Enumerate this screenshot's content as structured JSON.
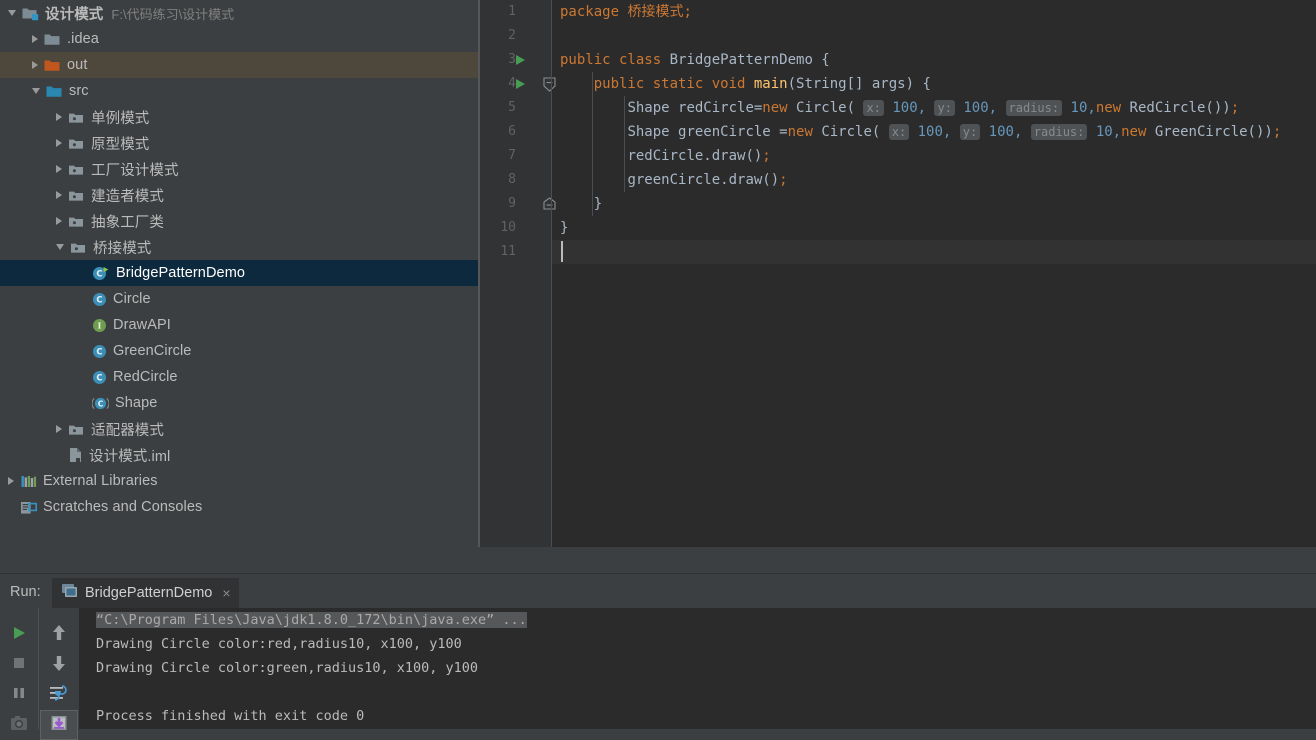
{
  "project_tree": {
    "items": [
      {
        "indent": 0,
        "arrow": "down",
        "icon": "module-folder-icon",
        "label": "设计模式",
        "path": "F:\\代码练习\\设计模式",
        "state": "normal",
        "bold": true
      },
      {
        "indent": 1,
        "arrow": "right",
        "icon": "folder-gray-icon",
        "label": ".idea",
        "path": "",
        "state": "normal",
        "bold": false
      },
      {
        "indent": 1,
        "arrow": "right",
        "icon": "folder-orange-icon",
        "label": "out",
        "path": "",
        "state": "hovered",
        "bold": false
      },
      {
        "indent": 1,
        "arrow": "down",
        "icon": "folder-source-icon",
        "label": "src",
        "path": "",
        "state": "normal",
        "bold": false
      },
      {
        "indent": 2,
        "arrow": "right",
        "icon": "package-icon",
        "label": "单例模式",
        "path": "",
        "state": "normal",
        "bold": false
      },
      {
        "indent": 2,
        "arrow": "right",
        "icon": "package-icon",
        "label": "原型模式",
        "path": "",
        "state": "normal",
        "bold": false
      },
      {
        "indent": 2,
        "arrow": "right",
        "icon": "package-icon",
        "label": "工厂设计模式",
        "path": "",
        "state": "normal",
        "bold": false
      },
      {
        "indent": 2,
        "arrow": "right",
        "icon": "package-icon",
        "label": "建造者模式",
        "path": "",
        "state": "normal",
        "bold": false
      },
      {
        "indent": 2,
        "arrow": "right",
        "icon": "package-icon",
        "label": "抽象工厂类",
        "path": "",
        "state": "normal",
        "bold": false
      },
      {
        "indent": 2,
        "arrow": "down",
        "icon": "package-icon",
        "label": "桥接模式",
        "path": "",
        "state": "normal",
        "bold": false
      },
      {
        "indent": 3,
        "arrow": "none",
        "icon": "java-class-runnable-icon",
        "label": "BridgePatternDemo",
        "path": "",
        "state": "selected",
        "bold": false
      },
      {
        "indent": 3,
        "arrow": "none",
        "icon": "java-class-icon",
        "label": "Circle",
        "path": "",
        "state": "normal",
        "bold": false
      },
      {
        "indent": 3,
        "arrow": "none",
        "icon": "java-interface-icon",
        "label": "DrawAPI",
        "path": "",
        "state": "normal",
        "bold": false
      },
      {
        "indent": 3,
        "arrow": "none",
        "icon": "java-class-icon",
        "label": "GreenCircle",
        "path": "",
        "state": "normal",
        "bold": false
      },
      {
        "indent": 3,
        "arrow": "none",
        "icon": "java-class-icon",
        "label": "RedCircle",
        "path": "",
        "state": "normal",
        "bold": false
      },
      {
        "indent": 3,
        "arrow": "none",
        "icon": "java-abstract-class-icon",
        "label": "Shape",
        "path": "",
        "state": "normal",
        "bold": false
      },
      {
        "indent": 2,
        "arrow": "right",
        "icon": "package-icon",
        "label": "适配器模式",
        "path": "",
        "state": "normal",
        "bold": false
      },
      {
        "indent": 2,
        "arrow": "none",
        "icon": "iml-file-icon",
        "label": "设计模式.iml",
        "path": "",
        "state": "normal",
        "bold": false
      },
      {
        "indent": 0,
        "arrow": "right",
        "icon": "external-libraries-icon",
        "label": "External Libraries",
        "path": "",
        "state": "normal",
        "bold": false
      },
      {
        "indent": 0,
        "arrow": "none",
        "icon": "scratches-icon",
        "label": "Scratches and Consoles",
        "path": "",
        "state": "normal",
        "bold": false
      }
    ]
  },
  "editor": {
    "line_numbers": [
      "1",
      "2",
      "3",
      "4",
      "5",
      "6",
      "7",
      "8",
      "9",
      "10",
      "11"
    ],
    "caret_line": 11,
    "gutter_run_markers": [
      3,
      4
    ],
    "gutter_fold_markers": [
      4,
      9
    ],
    "code": {
      "l1_package_kw": "package",
      "l1_package_name": " 桥接模式",
      "l1_semi": ";",
      "l3_mod": "public class",
      "l3_name": " BridgePatternDemo {",
      "l4_mod": "public static void ",
      "l4_main": "main",
      "l4_rest": "(String[] args) {",
      "l5_pre": "Shape redCircle=",
      "l5_new": "new",
      "l5_call": " Circle( ",
      "l5_hint_x": "x:",
      "l5_x": " 100, ",
      "l5_hint_y": "y:",
      "l5_y": " 100, ",
      "l5_hint_r": "radius:",
      "l5_r": " 10,",
      "l5_new2": "new",
      "l5_tail": " RedCircle())",
      "l5_semi": ";",
      "l6_pre": "Shape greenCircle =",
      "l6_new": "new",
      "l6_call": " Circle( ",
      "l6_hint_x": "x:",
      "l6_x": " 100, ",
      "l6_hint_y": "y:",
      "l6_y": " 100, ",
      "l6_hint_r": "radius:",
      "l6_r": " 10,",
      "l6_new2": "new",
      "l6_tail": " GreenCircle())",
      "l6_semi": ";",
      "l7_text": "redCircle.draw()",
      "l7_semi": ";",
      "l8_text": "greenCircle.draw()",
      "l8_semi": ";",
      "l9_text": "}",
      "l10_text": "}",
      "l11_text": ""
    }
  },
  "run_panel": {
    "label": "Run:",
    "tab_title": "BridgePatternDemo",
    "tab_close": "×",
    "toolbar_left": [
      {
        "name": "rerun-button",
        "icon": "play-icon"
      },
      {
        "name": "stop-button",
        "icon": "stop-icon"
      },
      {
        "name": "pause-output-button",
        "icon": "pause-icon"
      },
      {
        "name": "dump-threads-button",
        "icon": "camera-icon"
      }
    ],
    "toolbar_right": [
      {
        "name": "up-stack-button",
        "icon": "arrow-up-icon"
      },
      {
        "name": "down-stack-button",
        "icon": "arrow-down-icon"
      },
      {
        "name": "soft-wrap-button",
        "icon": "soft-wrap-icon"
      },
      {
        "name": "scroll-to-end-button",
        "icon": "scroll-to-end-icon"
      }
    ],
    "console_lines": [
      {
        "text": "“C:\\Program Files\\Java\\jdk1.8.0_172\\bin\\java.exe” ...",
        "highlight": true
      },
      {
        "text": "Drawing Circle color:red,radius10, x100, y100",
        "highlight": false
      },
      {
        "text": "Drawing Circle color:green,radius10, x100, y100",
        "highlight": false
      },
      {
        "text": "",
        "highlight": false
      },
      {
        "text": "Process finished with exit code 0",
        "highlight": false
      }
    ]
  },
  "colors": {
    "panel_bg": "#3c3f41",
    "editor_bg": "#2b2b2b",
    "gutter_bg": "#313335",
    "selection_bg": "#0d293e",
    "hover_bg": "#4e483c",
    "keyword": "#cc7832",
    "number": "#6897bb",
    "method": "#ffc66d",
    "text": "#a9b7c6",
    "run_green": "#499C54"
  }
}
